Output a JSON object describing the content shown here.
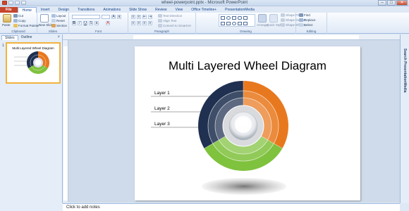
{
  "window": {
    "title": "wheel-powerpoint.pptx - Microsoft PowerPoint"
  },
  "ribbon_tabs": [
    "File",
    "Home",
    "Insert",
    "Design",
    "Transitions",
    "Animations",
    "Slide Show",
    "Review",
    "View",
    "Office Timeline+",
    "PresentationMedia"
  ],
  "ribbon": {
    "clipboard": {
      "label": "Clipboard",
      "paste": "Paste",
      "cut": "Cut",
      "copy": "Copy",
      "format_painter": "Format Painter"
    },
    "slides": {
      "label": "Slides",
      "new_slide": "New Slide",
      "layout": "Layout",
      "reset": "Reset",
      "section": "Section"
    },
    "font": {
      "label": "Font"
    },
    "paragraph": {
      "label": "Paragraph",
      "text_direction": "Text Direction",
      "align_text": "Align Text",
      "convert_smartart": "Convert to SmartArt"
    },
    "drawing": {
      "label": "Drawing",
      "arrange": "Arrange",
      "quick_styles": "Quick Styles",
      "shape_fill": "Shape Fill",
      "shape_outline": "Shape Outline",
      "shape_effects": "Shape Effects"
    },
    "editing": {
      "label": "Editing",
      "find": "Find",
      "replace": "Replace",
      "select": "Select"
    }
  },
  "left_panel": {
    "tabs": [
      "Slides",
      "Outline"
    ],
    "close": "×",
    "slide_number": "1",
    "thumb_title": "Multi Layered Wheel Diagram"
  },
  "slide": {
    "title": "Multi Layered Wheel Diagram",
    "layers": [
      "Layer 1",
      "Layer 2",
      "Layer 3"
    ],
    "colors": {
      "orange": "#e8781e",
      "navy": "#1f3050",
      "green": "#7fc23d"
    }
  },
  "right_pane": {
    "label": "Search PresentationMedia"
  },
  "notes": {
    "placeholder": "Click to add notes"
  }
}
